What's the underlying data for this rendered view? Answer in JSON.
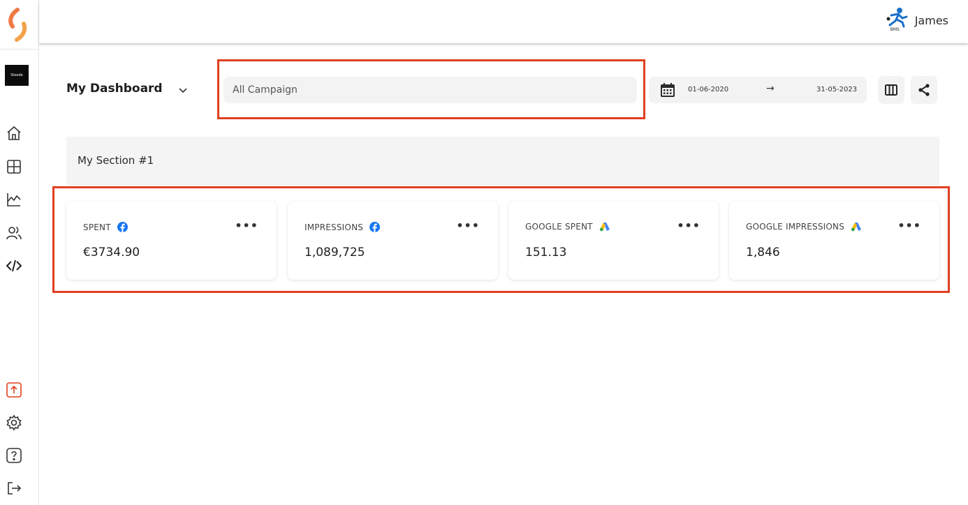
{
  "header": {
    "user_name": "James",
    "avatar_caption": "BMS"
  },
  "sidebar": {
    "brand_label": "Stoode",
    "items": [
      {
        "name": "home",
        "icon": "home-icon"
      },
      {
        "name": "layout",
        "icon": "layout-icon"
      },
      {
        "name": "analytics",
        "icon": "chart-icon"
      },
      {
        "name": "users",
        "icon": "users-icon"
      },
      {
        "name": "code",
        "icon": "code-icon"
      },
      {
        "name": "upload",
        "icon": "upload-icon"
      },
      {
        "name": "settings",
        "icon": "gear-icon"
      },
      {
        "name": "help",
        "icon": "help-icon"
      },
      {
        "name": "logout",
        "icon": "logout-icon"
      }
    ]
  },
  "dashboard": {
    "title": "My Dashboard",
    "campaign_placeholder": "All Campaign",
    "date_start": "01-06-2020",
    "date_arrow": "→",
    "date_end": "31-05-2023"
  },
  "section": {
    "title": "My Section #1"
  },
  "cards": [
    {
      "label": "SPENT",
      "value": "€3734.90",
      "source": "facebook"
    },
    {
      "label": "IMPRESSIONS",
      "value": "1,089,725",
      "source": "facebook"
    },
    {
      "label": "GOOGLE SPENT",
      "value": "151.13",
      "source": "google-ads"
    },
    {
      "label": "GOOGLE IMPRESSIONS",
      "value": "1,846",
      "source": "google-ads"
    }
  ],
  "colors": {
    "accent": "#e0401f",
    "facebook": "#1877f2",
    "logo": "#ee7a45"
  }
}
